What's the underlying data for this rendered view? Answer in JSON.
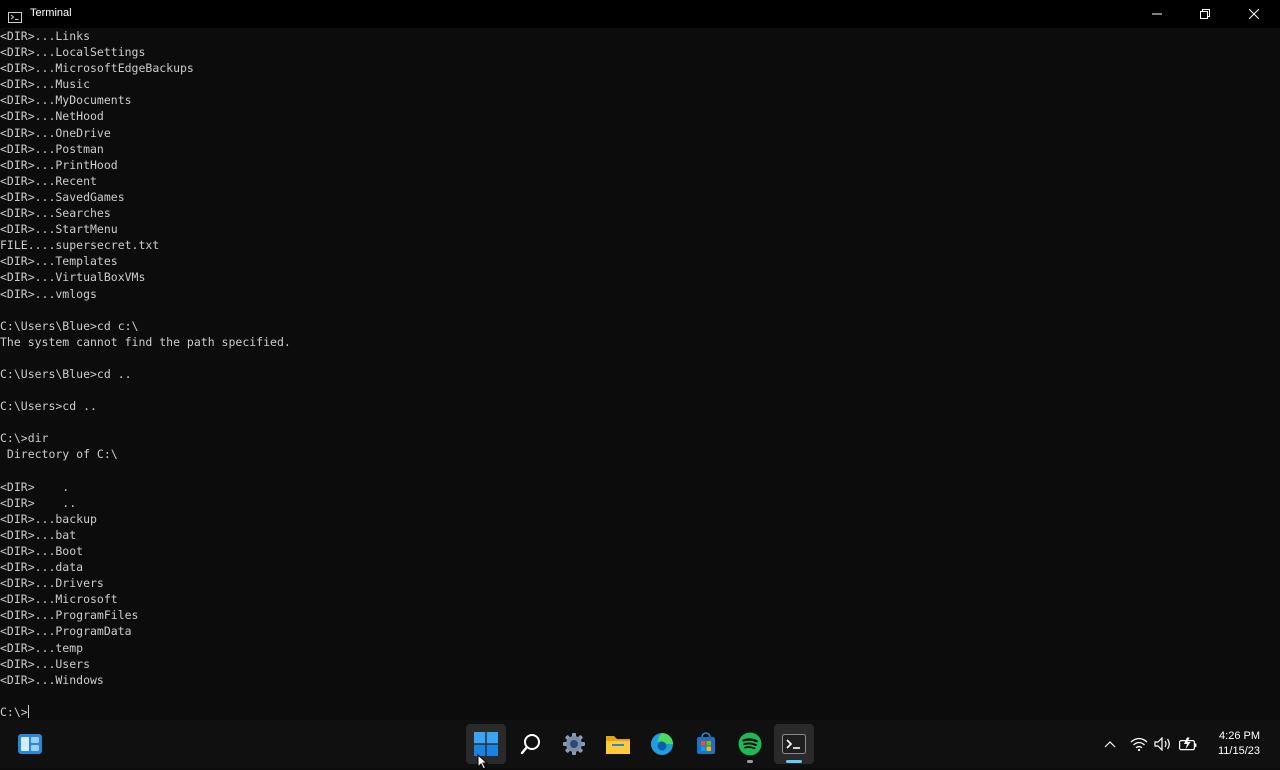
{
  "window": {
    "title": "Terminal",
    "icon": "terminal-icon"
  },
  "terminal": {
    "lines": [
      "<DIR>...Links",
      "<DIR>...LocalSettings",
      "<DIR>...MicrosoftEdgeBackups",
      "<DIR>...Music",
      "<DIR>...MyDocuments",
      "<DIR>...NetHood",
      "<DIR>...OneDrive",
      "<DIR>...Postman",
      "<DIR>...PrintHood",
      "<DIR>...Recent",
      "<DIR>...SavedGames",
      "<DIR>...Searches",
      "<DIR>...StartMenu",
      "FILE....supersecret.txt",
      "<DIR>...Templates",
      "<DIR>...VirtualBoxVMs",
      "<DIR>...vmlogs",
      "",
      "C:\\Users\\Blue>cd c:\\",
      "The system cannot find the path specified.",
      "",
      "C:\\Users\\Blue>cd ..",
      "",
      "C:\\Users>cd ..",
      "",
      "C:\\>dir",
      " Directory of C:\\",
      "",
      "<DIR>    .",
      "<DIR>    ..",
      "<DIR>...backup",
      "<DIR>...bat",
      "<DIR>...Boot",
      "<DIR>...data",
      "<DIR>...Drivers",
      "<DIR>...Microsoft",
      "<DIR>...ProgramFiles",
      "<DIR>...ProgramData",
      "<DIR>...temp",
      "<DIR>...Users",
      "<DIR>...Windows",
      ""
    ],
    "prompt": "C:\\>"
  },
  "taskbar": {
    "widgets_icon": "widgets-icon",
    "pinned": [
      {
        "name": "start-button",
        "icon": "windows-logo-icon",
        "active": true
      },
      {
        "name": "search-button",
        "icon": "search-icon",
        "active": false
      },
      {
        "name": "settings-button",
        "icon": "settings-gear-icon",
        "active": false
      },
      {
        "name": "file-explorer-button",
        "icon": "folder-icon",
        "active": false
      },
      {
        "name": "edge-button",
        "icon": "edge-browser-icon",
        "active": false
      },
      {
        "name": "store-button",
        "icon": "store-icon",
        "active": false
      },
      {
        "name": "spotify-button",
        "icon": "spotify-icon",
        "running": true
      },
      {
        "name": "terminal-button",
        "icon": "terminal-icon",
        "running": true,
        "focused": true
      }
    ],
    "tray": [
      "chevron-up-icon",
      "wifi-icon",
      "speaker-icon",
      "battery-icon"
    ]
  },
  "clock": {
    "time": "4:26 PM",
    "date": "11/15/23"
  },
  "colors": {
    "terminal_bg": "#0c0c0c",
    "terminal_text": "#cccccc",
    "titlebar_bg": "#000000",
    "taskbar_bg": "#101010",
    "accent": "#60cdff",
    "spotify": "#1db954"
  }
}
